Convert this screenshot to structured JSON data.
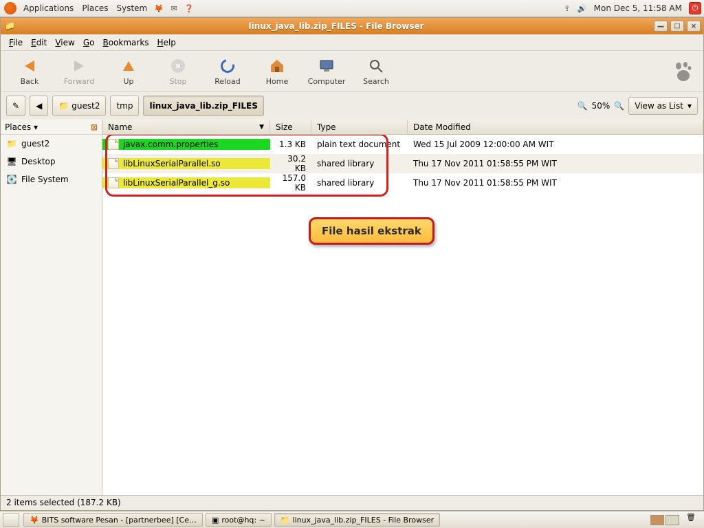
{
  "top_panel": {
    "menus": [
      "Applications",
      "Places",
      "System"
    ],
    "clock": "Mon Dec  5, 11:58 AM"
  },
  "window": {
    "title": "linux_java_lib.zip_FILES - File Browser",
    "menubar": {
      "file": "File",
      "edit": "Edit",
      "view": "View",
      "go": "Go",
      "bookmarks": "Bookmarks",
      "help": "Help"
    },
    "toolbar": {
      "back": "Back",
      "forward": "Forward",
      "up": "Up",
      "stop": "Stop",
      "reload": "Reload",
      "home": "Home",
      "computer": "Computer",
      "search": "Search"
    },
    "breadcrumb": {
      "items": [
        "guest2",
        "tmp",
        "linux_java_lib.zip_FILES"
      ]
    },
    "zoom": {
      "percent": "50%"
    },
    "viewas": {
      "label": "View as List"
    },
    "sidebar": {
      "title": "Places",
      "items": [
        {
          "label": "guest2"
        },
        {
          "label": "Desktop"
        },
        {
          "label": "File System"
        }
      ]
    },
    "columns": {
      "name": "Name",
      "size": "Size",
      "type": "Type",
      "date": "Date Modified"
    },
    "files": [
      {
        "name": "javax.comm.properties",
        "size": "1.3 KB",
        "type": "plain text document",
        "date": "Wed 15 Jul 2009 12:00:00 AM WIT",
        "hl": "green"
      },
      {
        "name": "libLinuxSerialParallel.so",
        "size": "30.2 KB",
        "type": "shared library",
        "date": "Thu 17 Nov 2011 01:58:55 PM WIT",
        "hl": "yellow"
      },
      {
        "name": "libLinuxSerialParallel_g.so",
        "size": "157.0 KB",
        "type": "shared library",
        "date": "Thu 17 Nov 2011 01:58:55 PM WIT",
        "hl": "yellow"
      }
    ],
    "annotation": "File hasil ekstrak",
    "status": "2 items selected (187.2 KB)"
  },
  "bottom_panel": {
    "tasks": [
      "BITS software Pesan - [partnerbee] [Ce…",
      "root@hq: ~",
      "linux_java_lib.zip_FILES - File Browser"
    ]
  }
}
